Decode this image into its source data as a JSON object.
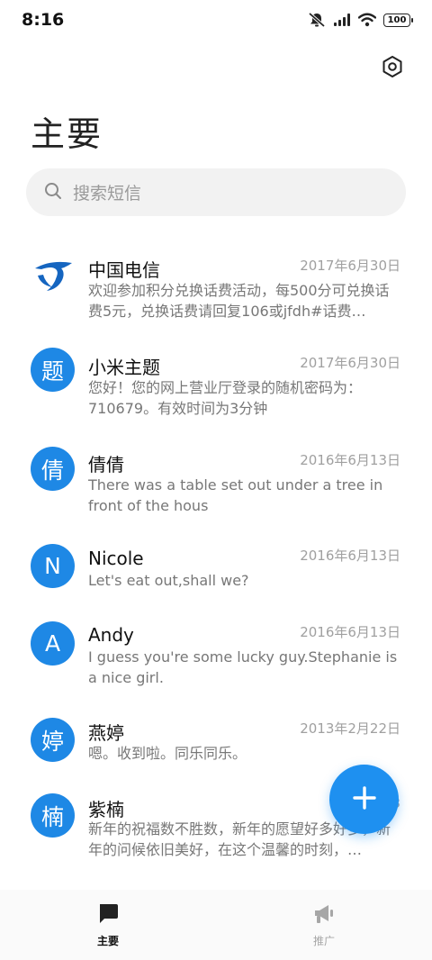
{
  "status": {
    "time": "8:16",
    "battery": "100"
  },
  "header": {
    "title": "主要"
  },
  "search": {
    "placeholder": "搜索短信"
  },
  "messages": [
    {
      "sender": "中国电信",
      "date": "2017年6月30日",
      "preview": "欢迎参加积分兑换话费活动，每500分可兑换话费5元，兑换话费请回复106或jfdh#话费…",
      "avatar": ""
    },
    {
      "sender": "小米主题",
      "date": "2017年6月30日",
      "preview": "您好！您的网上营业厅登录的随机密码为：710679。有效时间为3分钟",
      "avatar": "题"
    },
    {
      "sender": "倩倩",
      "date": "2016年6月13日",
      "preview": "There was a table set out under a tree in front of the hous",
      "avatar": "倩"
    },
    {
      "sender": "Nicole",
      "date": "2016年6月13日",
      "preview": "Let's eat out,shall we?",
      "avatar": "N"
    },
    {
      "sender": "Andy",
      "date": "2016年6月13日",
      "preview": "I guess you're some lucky guy.Stephanie is a nice girl.",
      "avatar": "A"
    },
    {
      "sender": "燕婷",
      "date": "2013年2月22日",
      "preview": "嗯。收到啦。同乐同乐。",
      "avatar": "婷"
    },
    {
      "sender": "紫楠",
      "date": "2013",
      "preview": "新年的祝福数不胜数，新年的愿望好多好多，新年的问候依旧美好，在这个温馨的时刻，…",
      "avatar": "楠"
    }
  ],
  "nav": {
    "primary_label": "主要",
    "promo_label": "推广"
  },
  "colors": {
    "accent": "#1e88e5",
    "fab": "#1e90f0"
  }
}
